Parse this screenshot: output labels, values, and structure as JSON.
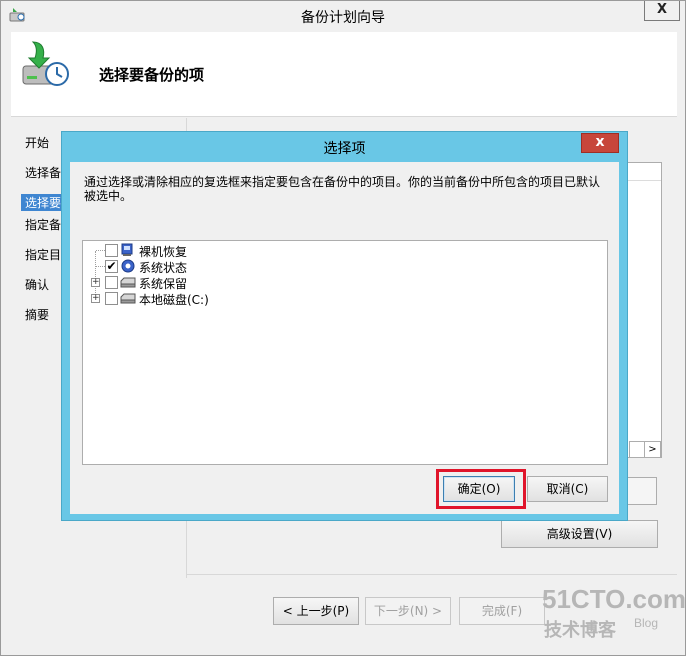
{
  "window": {
    "title": "备份计划向导",
    "close_label": "X"
  },
  "header": {
    "title": "选择要备份的项"
  },
  "nav": {
    "items": [
      {
        "label": "开始",
        "active": false
      },
      {
        "label": "选择备",
        "active": false
      },
      {
        "label": "选择要",
        "active": true
      },
      {
        "label": "指定备",
        "active": false
      },
      {
        "label": "指定目",
        "active": false
      },
      {
        "label": "确认",
        "active": false
      },
      {
        "label": "摘要",
        "active": false
      }
    ]
  },
  "content": {
    "advanced_settings_label": "高级设置(V)",
    "scroll_right": ">"
  },
  "footer": {
    "prev_label": "< 上一步(P)",
    "next_label": "下一步(N) >",
    "finish_label": "完成(F)"
  },
  "dialog": {
    "title": "选择项",
    "close_label": "x",
    "description": "通过选择或清除相应的复选框来指定要包含在备份中的项目。你的当前备份中所包含的项目已默认被选中。",
    "tree": [
      {
        "label": "裸机恢复",
        "checked": false,
        "expandable": false,
        "icon": "bare-metal-icon"
      },
      {
        "label": "系统状态",
        "checked": true,
        "expandable": false,
        "icon": "system-state-icon"
      },
      {
        "label": "系统保留",
        "checked": false,
        "expandable": true,
        "icon": "drive-icon"
      },
      {
        "label": "本地磁盘(C:)",
        "checked": false,
        "expandable": true,
        "icon": "drive-icon"
      }
    ],
    "ok_label": "确定(O)",
    "cancel_label": "取消(C)",
    "check_mark": "✔",
    "expand_mark": "+"
  },
  "watermark": {
    "line1": "51CTO.com",
    "line2": "技术博客",
    "line3": "Blog"
  },
  "colors": {
    "dialog_frame": "#69c7e6",
    "close_red": "#c7463a",
    "nav_active": "#3f86d1",
    "highlight": "#e0152b"
  }
}
